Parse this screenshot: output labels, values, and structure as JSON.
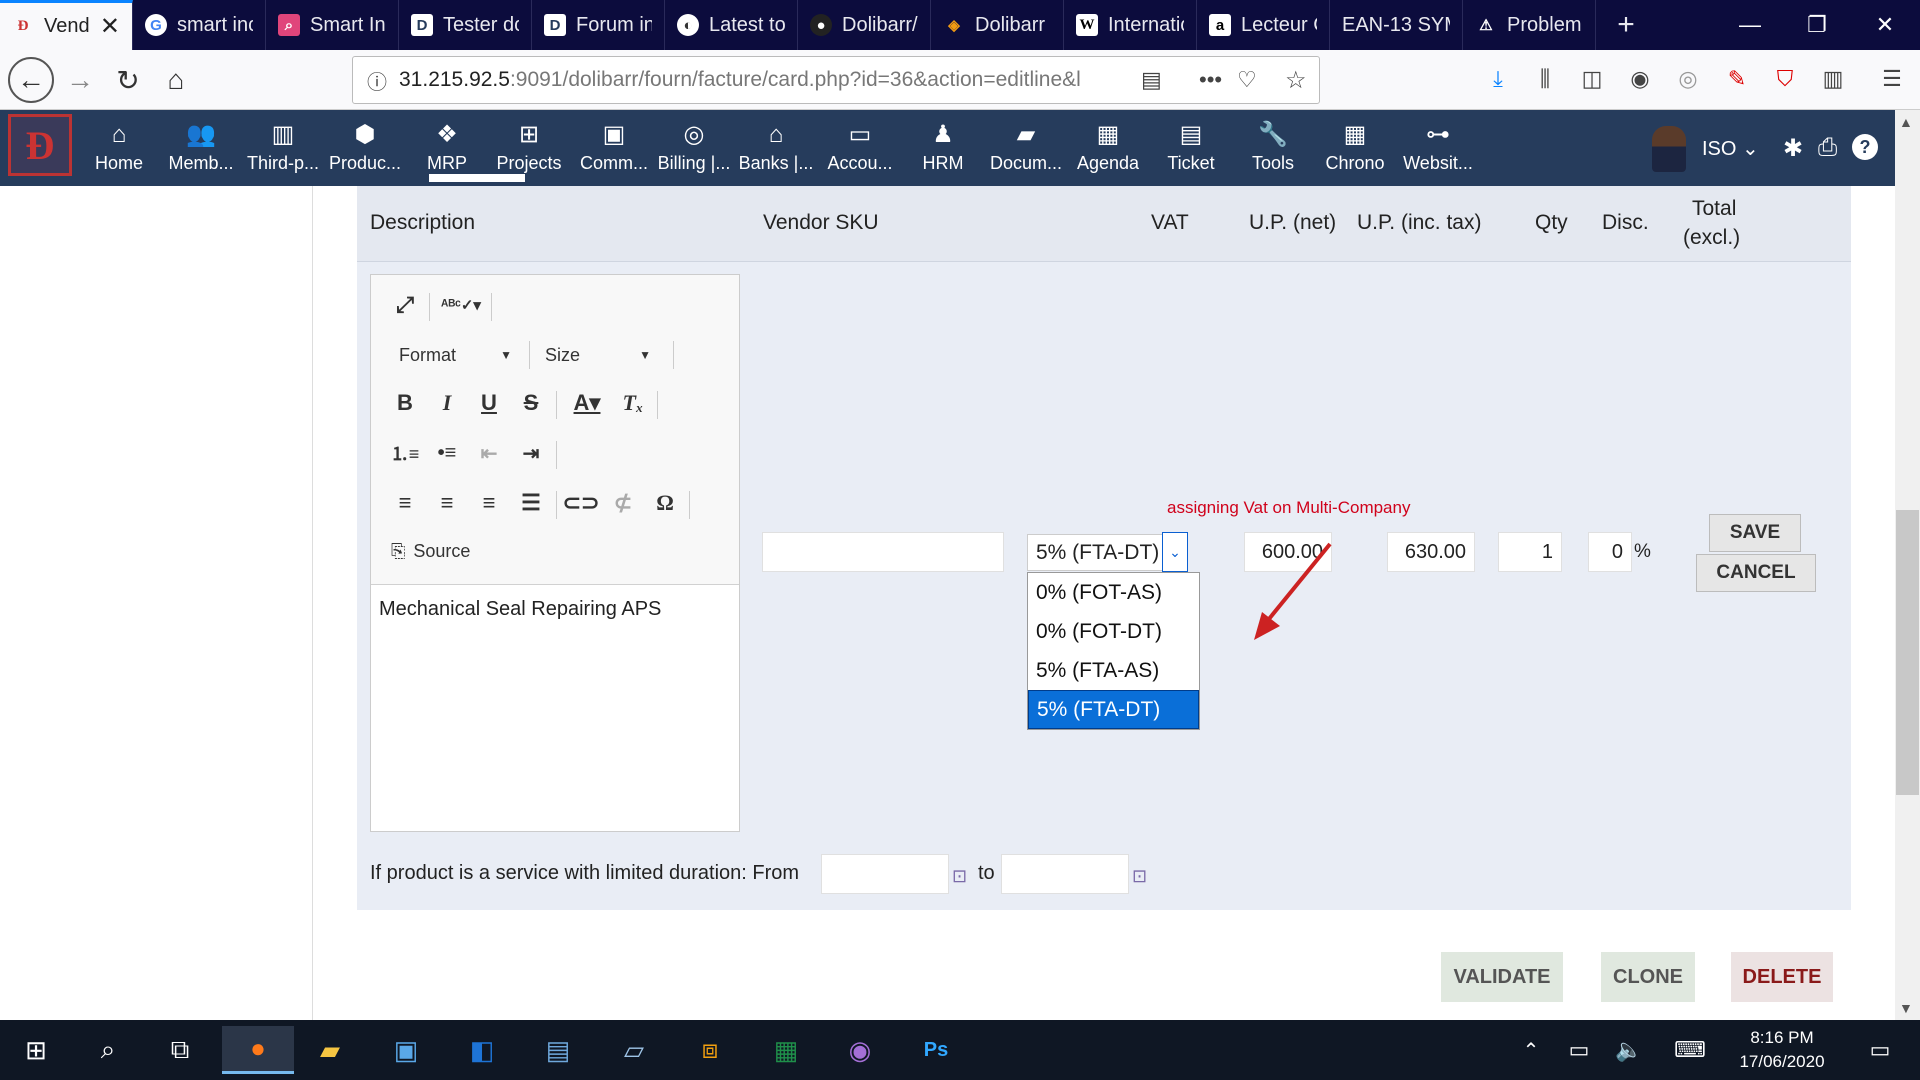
{
  "browser": {
    "tabs": [
      {
        "label": "Vend",
        "icon": "dolibarr-icon"
      },
      {
        "label": "smart inc",
        "icon": "google-icon"
      },
      {
        "label": "Smart In",
        "icon": "search-icon"
      },
      {
        "label": "Tester dc",
        "icon": "dolibarr-d-icon"
      },
      {
        "label": "Forum in",
        "icon": "dolibarr-d-icon"
      },
      {
        "label": "Latest to",
        "icon": "discourse-icon"
      },
      {
        "label": "Dolibarr/",
        "icon": "github-icon"
      },
      {
        "label": "Dolibarr",
        "icon": "dolibarr-diamond-icon"
      },
      {
        "label": "Internatic",
        "icon": "wikipedia-icon"
      },
      {
        "label": "Lecteur C",
        "icon": "amazon-icon"
      },
      {
        "label": "EAN-13 SYM",
        "icon": "barcode-icon"
      },
      {
        "label": "Problem",
        "icon": "warning-icon"
      }
    ],
    "url_host": "31.215.92.5",
    "url_rest": ":9091/dolibarr/fourn/facture/card.php?id=36&action=editline&l"
  },
  "menu": {
    "items": [
      {
        "label": "Home",
        "icon": "home-icon"
      },
      {
        "label": "Memb...",
        "icon": "members-icon"
      },
      {
        "label": "Third-p...",
        "icon": "building-icon"
      },
      {
        "label": "Produc...",
        "icon": "box-icon"
      },
      {
        "label": "MRP",
        "icon": "cubes-icon"
      },
      {
        "label": "Projects",
        "icon": "sitemap-icon"
      },
      {
        "label": "Comm...",
        "icon": "suitcase-icon"
      },
      {
        "label": "Billing |...",
        "icon": "coins-icon"
      },
      {
        "label": "Banks |...",
        "icon": "bank-icon"
      },
      {
        "label": "Accou...",
        "icon": "money-check-icon"
      },
      {
        "label": "HRM",
        "icon": "user-tie-icon"
      },
      {
        "label": "Docum...",
        "icon": "folder-icon"
      },
      {
        "label": "Agenda",
        "icon": "calendar-icon"
      },
      {
        "label": "Ticket",
        "icon": "ticket-icon"
      },
      {
        "label": "Tools",
        "icon": "wrench-icon"
      },
      {
        "label": "Chrono",
        "icon": "chrono-icon"
      },
      {
        "label": "Websit...",
        "icon": "website-icon"
      }
    ],
    "user": "ISO"
  },
  "table": {
    "headers": {
      "description": "Description",
      "vendor_sku": "Vendor SKU",
      "vat": "VAT",
      "up_net": "U.P. (net)",
      "up_inc": "U.P. (inc. tax)",
      "qty": "Qty",
      "disc": "Disc.",
      "total": "Total",
      "total2": "(excl.)"
    }
  },
  "editor": {
    "format_label": "Format",
    "size_label": "Size",
    "source_label": "Source",
    "content": "Mechanical Seal Repairing APS"
  },
  "line": {
    "vendor_sku": "",
    "vat_selected": "5% (FTA-DT)",
    "vat_options": [
      "0% (FOT-AS)",
      "0% (FOT-DT)",
      "5% (FTA-AS)",
      "5% (FTA-DT)"
    ],
    "up_net": "600.00",
    "up_inc": "630.00",
    "qty": "1",
    "disc": "0",
    "disc_unit": "%"
  },
  "annotation": "assigning Vat on Multi-Company",
  "buttons": {
    "save": "SAVE",
    "cancel": "CANCEL",
    "validate": "VALIDATE",
    "clone": "CLONE",
    "delete": "DELETE"
  },
  "duration": {
    "label": "If product is a service with limited duration: From",
    "to": "to"
  },
  "taskbar": {
    "time": "8:16 PM",
    "date": "17/06/2020"
  },
  "colors": {
    "menu_bg": "#263c5c",
    "selected_option": "#0a6fd8",
    "annotation": "#d0021b",
    "arrow": "#cc2222"
  }
}
